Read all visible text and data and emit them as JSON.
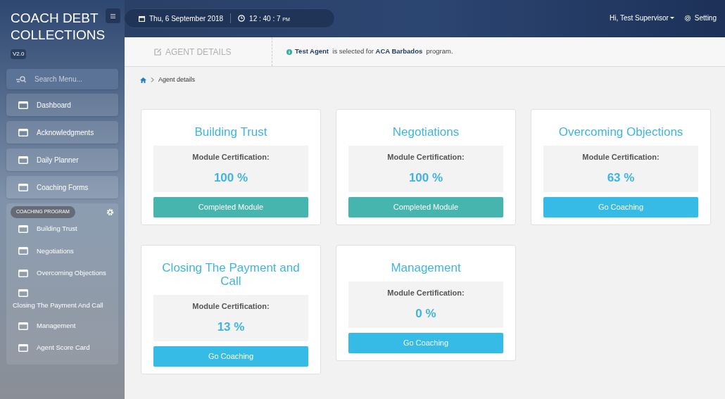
{
  "brand": {
    "title": "COACH DEBT COLLECTIONS",
    "version": "V2.0"
  },
  "topbar": {
    "date": "Thu, 6 September 2018",
    "time": "12 : 40 : 7",
    "meridiem": "PM",
    "user": "Hi, Test Supervisor",
    "settings": "Setting"
  },
  "sidebar": {
    "search_placeholder": "Search Menu...",
    "items": [
      {
        "label": "Dashboard"
      },
      {
        "label": "Acknowledgments"
      },
      {
        "label": "Daily Planner"
      },
      {
        "label": "Coaching Forms"
      }
    ],
    "section": {
      "title": "COACHING PROGRAM",
      "items": [
        {
          "label": "Building Trust",
          "kind": "inline"
        },
        {
          "label": "Negotiations",
          "kind": "inline"
        },
        {
          "label": "Overcoming Objections",
          "kind": "inline"
        },
        {
          "label": "Closing The Payment And Call",
          "kind": "wrapped"
        },
        {
          "label": "Management",
          "kind": "inline"
        },
        {
          "label": "Agent Score Card",
          "kind": "inline"
        }
      ]
    }
  },
  "page_header": {
    "title": "AGENT DETAILS",
    "info": "**Test Agent**  is selected for **ACA Barbados**  program."
  },
  "breadcrumb": [
    "Agent details"
  ],
  "modules": [
    {
      "title": "Building Trust",
      "label": "Module Certification:",
      "value": "100 %",
      "button": "Completed Module",
      "kind": "completed"
    },
    {
      "title": "Negotiations",
      "label": "Module Certification:",
      "value": "100 %",
      "button": "Completed Module",
      "kind": "completed"
    },
    {
      "title": "Overcoming Objections",
      "label": "Module Certification:",
      "value": "63 %",
      "button": "Go Coaching",
      "kind": "coaching"
    },
    {
      "title": "Closing The Payment and Call",
      "label": "Module Certification:",
      "value": "13 %",
      "button": "Go Coaching",
      "kind": "coaching"
    },
    {
      "title": "Management",
      "label": "Module Certification:",
      "value": "0 %",
      "button": "Go Coaching",
      "kind": "coaching"
    }
  ]
}
